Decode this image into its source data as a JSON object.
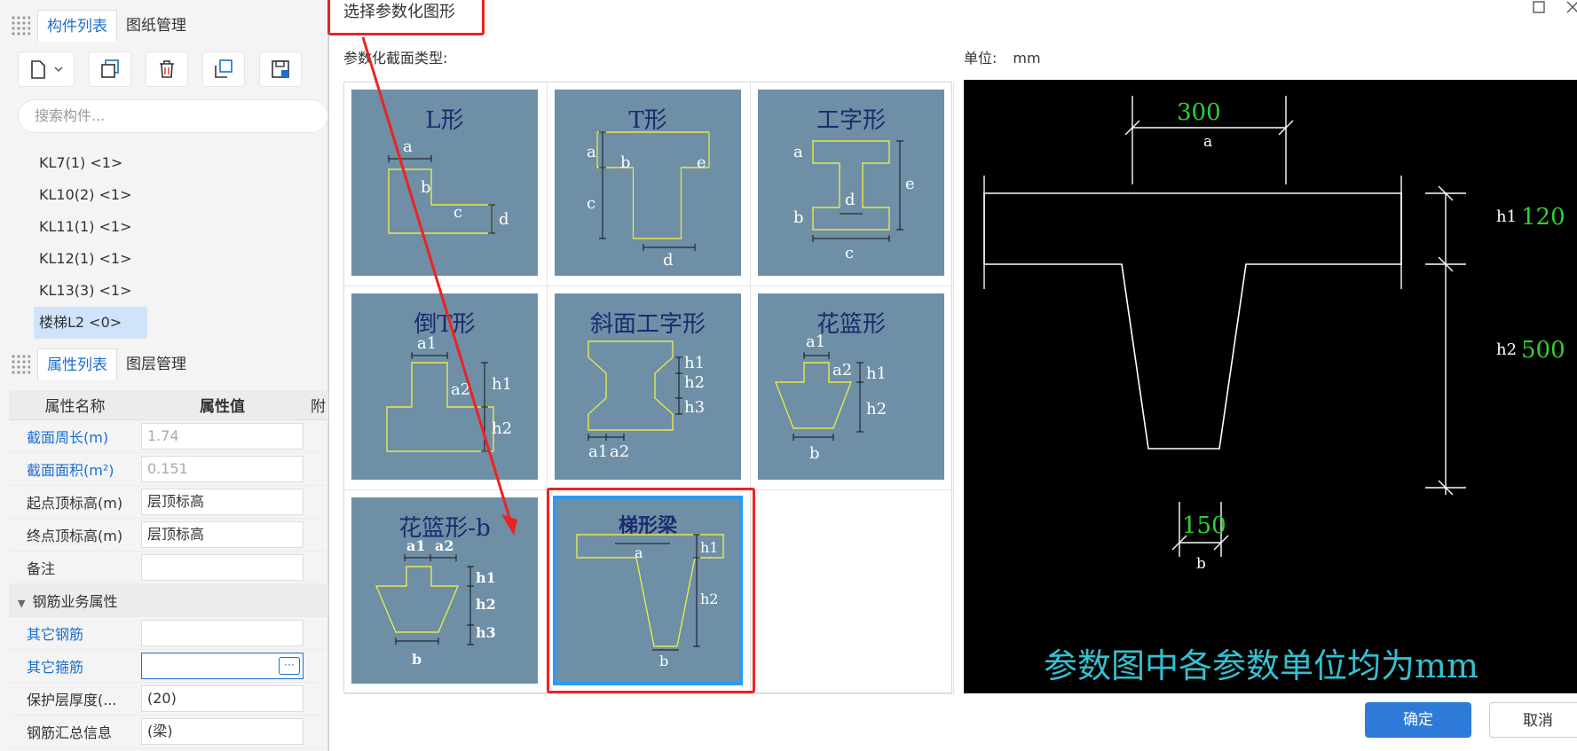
{
  "left_panel": {
    "top_tabs": [
      "构件列表",
      "图纸管理"
    ],
    "search_placeholder": "搜索构件...",
    "components": [
      "KL7(1) <1>",
      "KL10(2) <1>",
      "KL11(1) <1>",
      "KL12(1) <1>",
      "KL13(3) <1>",
      "楼梯L2 <0>"
    ],
    "selected_component": "楼梯L2 <0>",
    "bottom_tabs": [
      "属性列表",
      "图层管理"
    ],
    "prop_headers": [
      "属性名称",
      "属性值",
      "附"
    ],
    "props": [
      {
        "name": "截面周长(m)",
        "value": "1.74"
      },
      {
        "name": "截面面积(m²)",
        "value": "0.151"
      },
      {
        "name": "起点顶标高(m)",
        "value": "层顶标高"
      },
      {
        "name": "终点顶标高(m)",
        "value": "层顶标高"
      },
      {
        "name": "备注",
        "value": ""
      }
    ],
    "group_label": "钢筋业务属性",
    "props2": [
      {
        "name": "其它钢筋",
        "value": ""
      },
      {
        "name": "其它箍筋",
        "value": ""
      },
      {
        "name": "保护层厚度(...",
        "value": "(20)"
      },
      {
        "name": "钢筋汇总信息",
        "value": "(梁)"
      }
    ],
    "more_button": "···"
  },
  "dialog": {
    "title": "选择参数化图形",
    "section_label": "参数化截面类型:",
    "unit_label": "单位:",
    "unit_value": "mm",
    "shapes": [
      "L形",
      "T形",
      "工字形",
      "倒T形",
      "斜面工字形",
      "花篮形",
      "花篮形-b",
      "梯形梁"
    ],
    "selected_shape": "梯形梁",
    "preview": {
      "a_value": "300",
      "h1_value": "120",
      "h2_value": "500",
      "b_value": "150",
      "labels": {
        "a": "a",
        "b": "b",
        "h1": "h1",
        "h2": "h2"
      },
      "note": "参数图中各参数单位均为mm"
    },
    "ok_label": "确定",
    "cancel_label": "取消"
  },
  "colors": {
    "accent": "#2d7ad9",
    "highlight": "#ee2222",
    "thumb_bg": "#6e8fa6",
    "shape_line": "#e8e84a"
  }
}
